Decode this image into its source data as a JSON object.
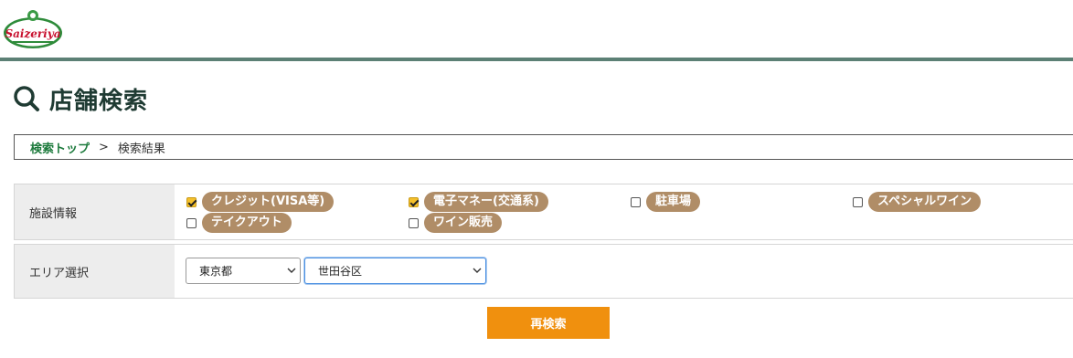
{
  "header": {
    "logo_text": "Saizeriya"
  },
  "page": {
    "title": "店舗検索"
  },
  "breadcrumb": {
    "link": "検索トップ",
    "separator": ">",
    "current": "検索結果"
  },
  "filters": {
    "facility_label": "施設情報",
    "facility_options": [
      {
        "label": "クレジット(VISA等)",
        "checked": true
      },
      {
        "label": "電子マネー(交通系)",
        "checked": true
      },
      {
        "label": "駐車場",
        "checked": false
      },
      {
        "label": "スペシャルワイン",
        "checked": false
      },
      {
        "label": "テイクアウト",
        "checked": false
      },
      {
        "label": "ワイン販売",
        "checked": false
      }
    ],
    "area_label": "エリア選択",
    "prefecture": "東京都",
    "city": "世田谷区"
  },
  "actions": {
    "research_label": "再検索"
  },
  "colors": {
    "accent": "#f0900e",
    "pill": "#b08d67",
    "header_line": "#5c8075",
    "link": "#1c7a3c"
  }
}
